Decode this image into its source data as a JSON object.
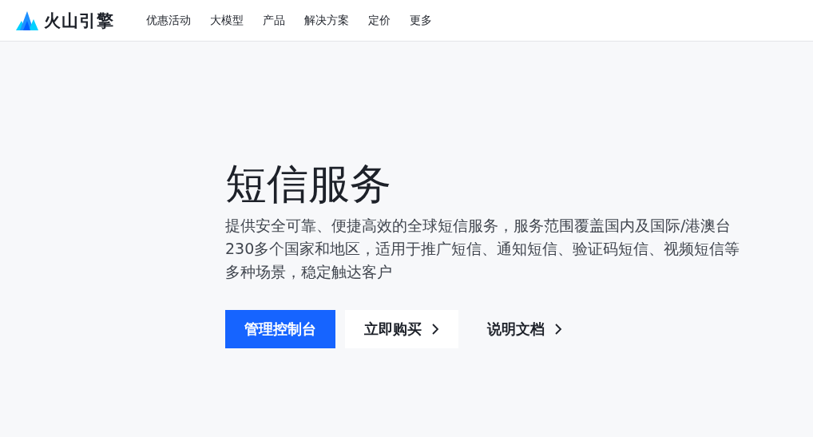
{
  "header": {
    "brand": "火山引擎",
    "nav": [
      {
        "label": "优惠活动"
      },
      {
        "label": "大模型"
      },
      {
        "label": "产品"
      },
      {
        "label": "解决方案"
      },
      {
        "label": "定价"
      },
      {
        "label": "更多"
      }
    ]
  },
  "hero": {
    "title": "短信服务",
    "description": "提供安全可靠、便捷高效的全球短信服务，服务范围覆盖国内及国际/港澳台230多个国家和地区，适用于推广短信、通知短信、验证码短信、视频短信等多种场景，稳定触达客户",
    "buttons": [
      {
        "label": "管理控制台",
        "kind": "primary"
      },
      {
        "label": "立即购买",
        "kind": "secondary"
      },
      {
        "label": "说明文档",
        "kind": "text"
      }
    ]
  }
}
